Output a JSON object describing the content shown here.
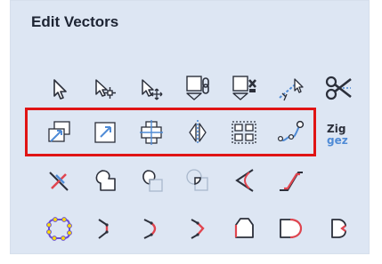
{
  "panel": {
    "title": "Edit Vectors",
    "rows": [
      [
        "select-icon",
        "node-edit-icon",
        "transform-icon",
        "group-icon",
        "ungroup-icon",
        "interactive-trim-icon",
        "scissors-icon"
      ],
      [
        "move-icon",
        "scale-icon",
        "align-center-icon",
        "mirror-icon",
        "array-copy-icon",
        "nest-parts-icon",
        "text-tool-icon"
      ],
      [
        "offset-icon",
        "weld-icon",
        "subtract-icon",
        "intersect-icon",
        "fillet-icon",
        "chamfer-icon"
      ],
      [
        "polyline-icon",
        "join-open-icon",
        "join-curve-icon",
        "join-sharp-icon",
        "close-vector-icon",
        "smooth-vector-icon",
        "extend-vector-icon"
      ]
    ]
  },
  "colors": {
    "panel_bg": "#dde6f3",
    "icon_blue": "#4f8bd6",
    "icon_dark": "#2b2f3a",
    "node_fill": "#ffe000",
    "node_stroke": "#6a4fd0",
    "highlight": "#e01414"
  }
}
